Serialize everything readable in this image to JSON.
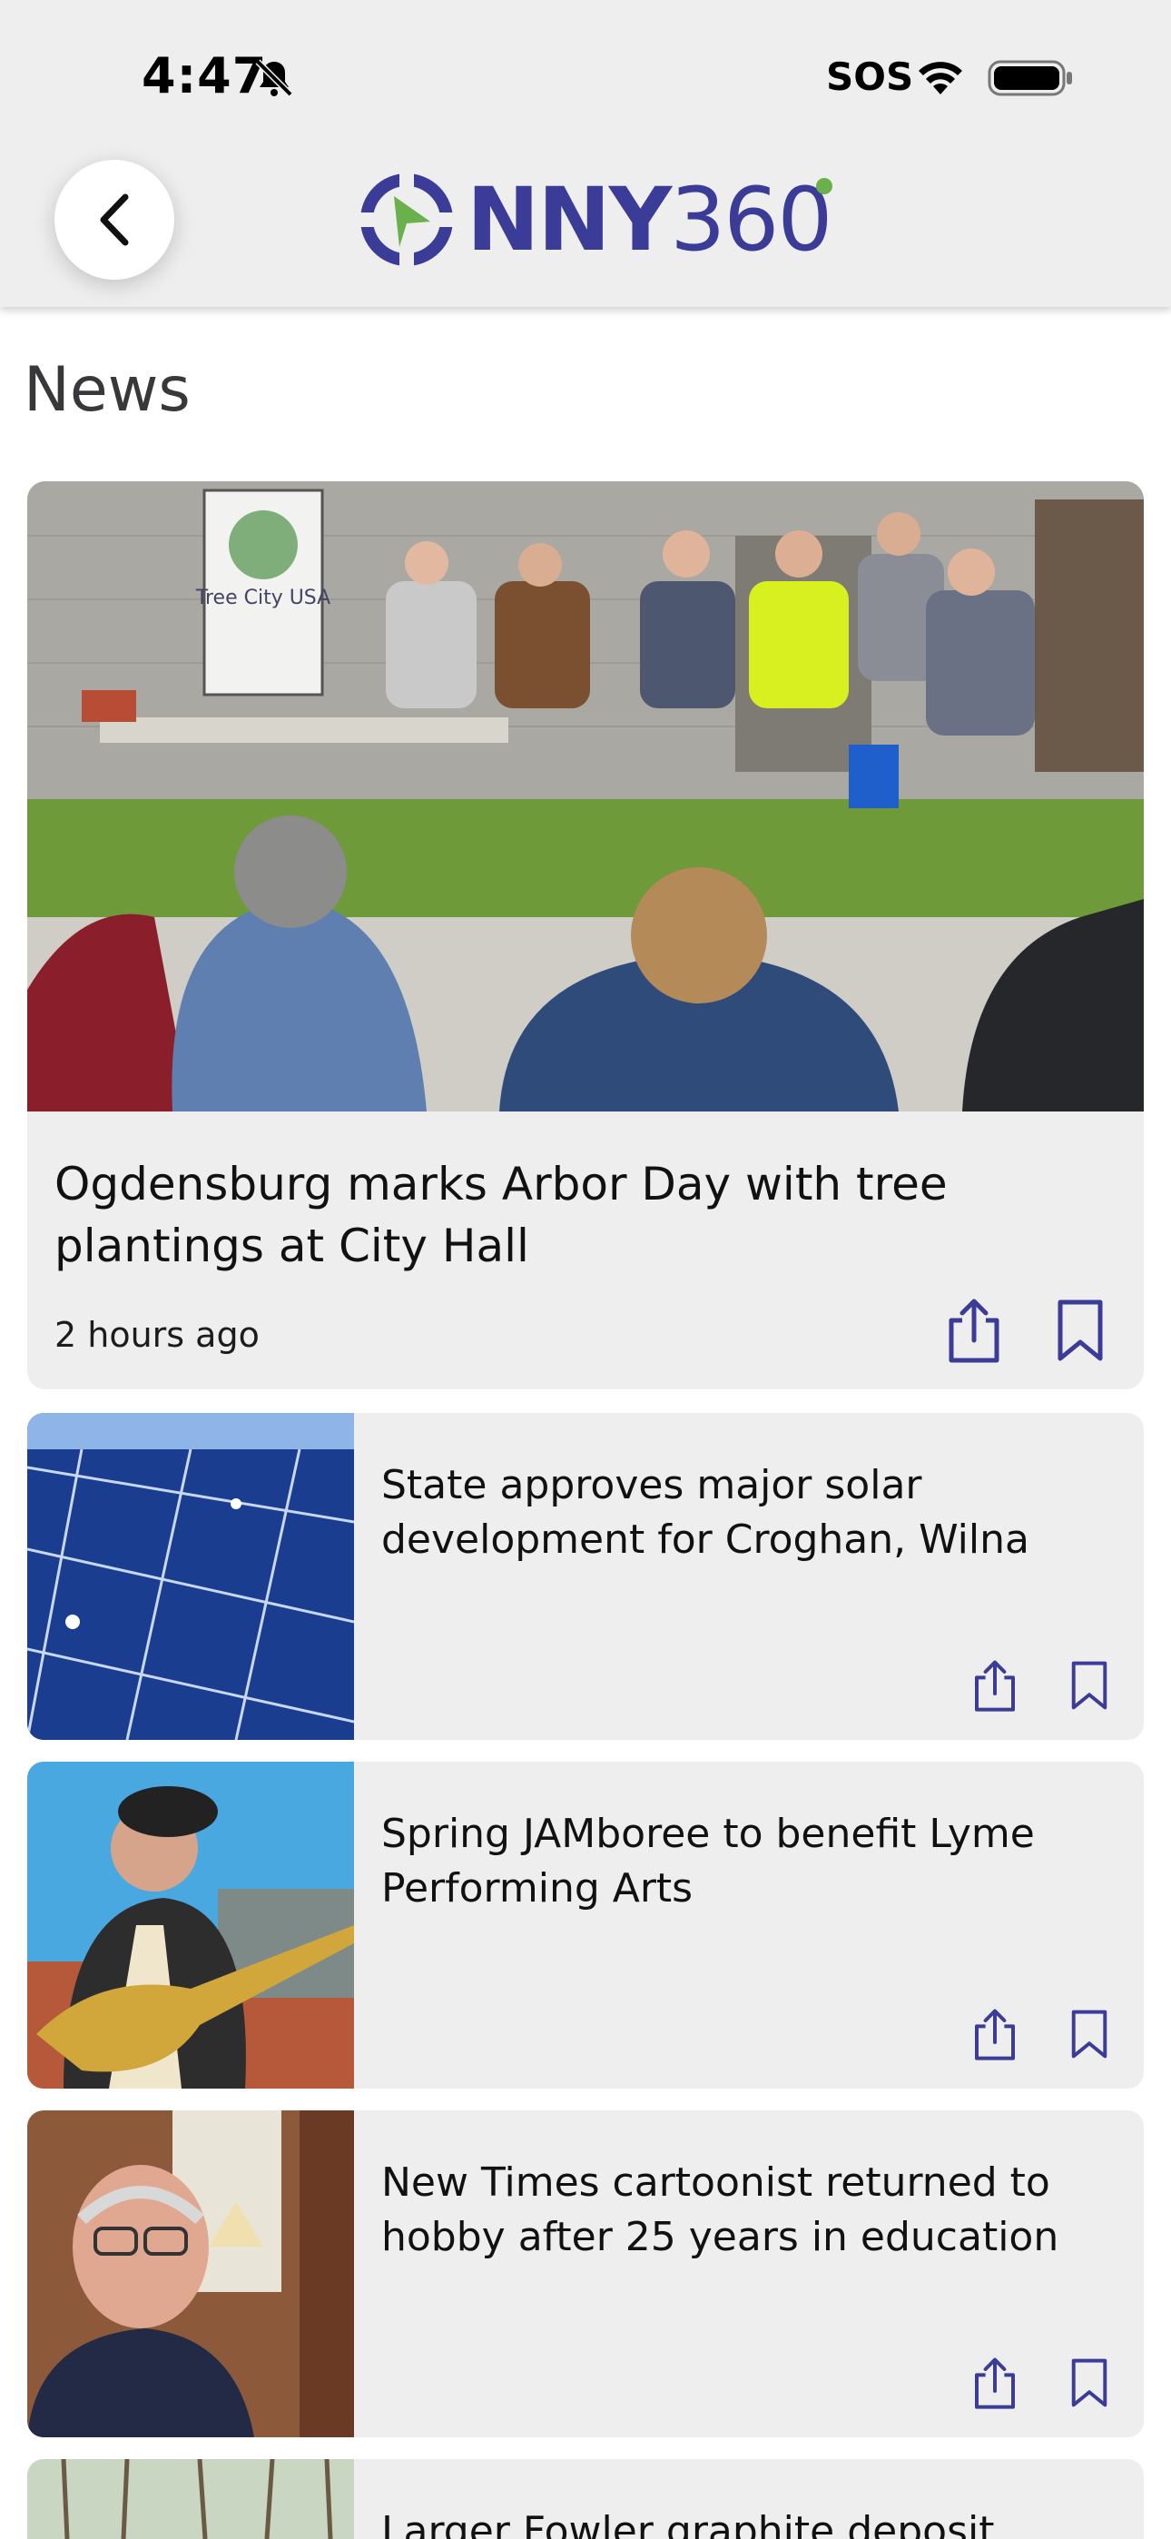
{
  "status_bar": {
    "time": "4:47",
    "sos": "SOS"
  },
  "header": {
    "logo_text_bold": "NNY",
    "logo_text_num": "360"
  },
  "section": {
    "title": "News"
  },
  "featured": {
    "title": "Ogdensburg marks Arbor Day with tree plantings at City Hall",
    "time": "2 hours ago",
    "banner_text": "Tree City USA"
  },
  "articles": [
    {
      "title": "State approves major solar development for Croghan, Wilna"
    },
    {
      "title": "Spring JAMboree to benefit Lyme Performing Arts"
    },
    {
      "title": "New Times cartoonist returned to hobby after 25 years in education"
    },
    {
      "title": "Larger Fowler graphite deposit could"
    }
  ],
  "colors": {
    "brand": "#3b3c97",
    "accent_green": "#6ab04c",
    "card_bg": "#eeeeef"
  },
  "icons": [
    "back-chevron-icon",
    "share-icon",
    "bookmark-icon",
    "bell-slash-icon",
    "wifi-icon",
    "battery-icon"
  ]
}
